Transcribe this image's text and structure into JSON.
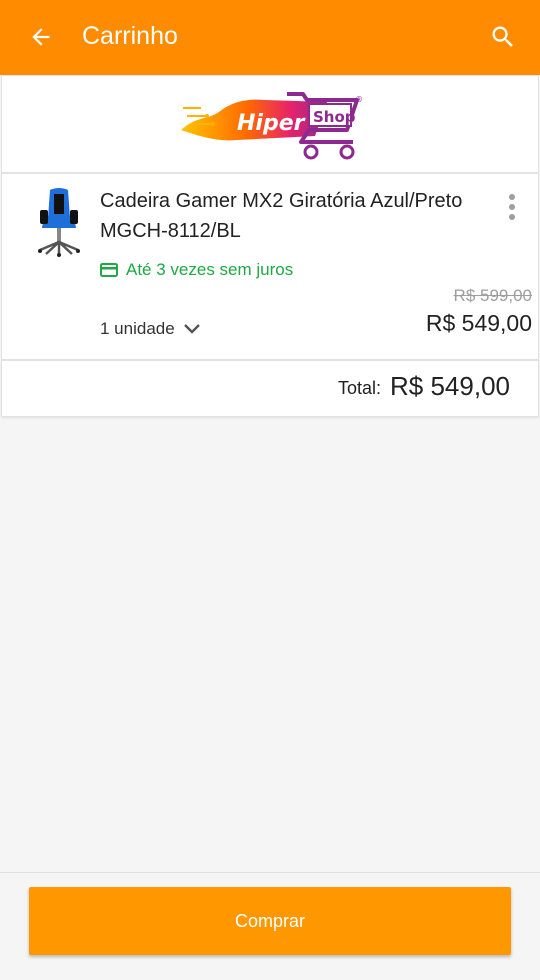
{
  "appbar": {
    "title": "Carrinho",
    "back_icon": "arrow-left-icon",
    "search_icon": "search-icon",
    "color": "#ff8c00"
  },
  "brand": {
    "logo_text_1": "Hiper",
    "logo_text_2": "Shop",
    "registered": "®"
  },
  "cart": {
    "items": [
      {
        "title": "Cadeira Gamer MX2 Giratória Azul/Preto MGCH-8112/BL",
        "installments": "Até 3 vezes sem juros",
        "installments_icon": "credit-card-icon",
        "quantity": "1 unidade",
        "old_price": "R$ 599,00",
        "price": "R$ 549,00",
        "more_icon": "more-vert-icon"
      }
    ],
    "total_label": "Total:",
    "total_value": "R$ 549,00"
  },
  "footer": {
    "buy_label": "Comprar",
    "buy_color": "#ff9800"
  }
}
